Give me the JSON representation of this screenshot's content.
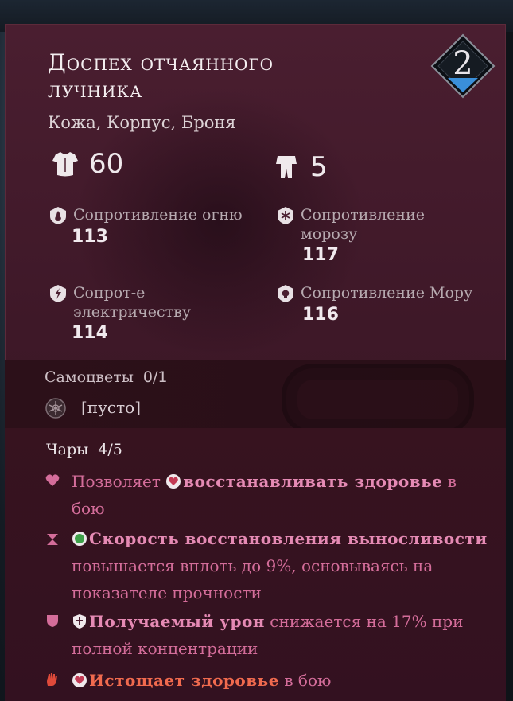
{
  "item": {
    "name_line1": "Доспех отчаянного",
    "name_line2": "лучника",
    "type": "Кожа, Корпус, Броня",
    "level": "2"
  },
  "main_stats": {
    "armor_value": "60",
    "weight_value": "5"
  },
  "resistances": [
    {
      "label": "Сопротивление огню",
      "value": "113"
    },
    {
      "label": "Сопротивление морозу",
      "value": "117"
    },
    {
      "label": "Сопрот-е электричеству",
      "value": "114"
    },
    {
      "label": "Сопротивление Мору",
      "value": "116"
    }
  ],
  "gems": {
    "label": "Самоцветы",
    "count": "0/1",
    "slot_text": "[пусто]"
  },
  "enchantments": {
    "label": "Чары",
    "count": "4/5",
    "items": [
      {
        "pre": "Позволяет",
        "bold": "восстанавливать здоровье",
        "post": "в бою"
      },
      {
        "pre": "",
        "bold": "Скорость восстановления выносливости",
        "post": "повышается вплоть до 9%, основываясь на показателе прочности"
      },
      {
        "pre": "",
        "bold": "Получаемый урон",
        "post": "снижается на 17% при полной концентрации"
      },
      {
        "pre": "",
        "bold": "Истощает здоровье",
        "post": "в бою"
      }
    ]
  },
  "colors": {
    "enchant_text": "#d46d9a",
    "enchant_bold": "#e58ab4",
    "curse_text": "#f06a4e",
    "card_bg": "#4a1e30",
    "level_accent": "#3a8fd9"
  },
  "icons": {
    "armor": "chestplate-icon",
    "weight": "weight-icon",
    "fire": "fire-resistance-icon",
    "frost": "frost-resistance-icon",
    "shock": "shock-resistance-icon",
    "rot": "rot-resistance-icon",
    "gem_slot": "empty-gem-slot-icon"
  }
}
